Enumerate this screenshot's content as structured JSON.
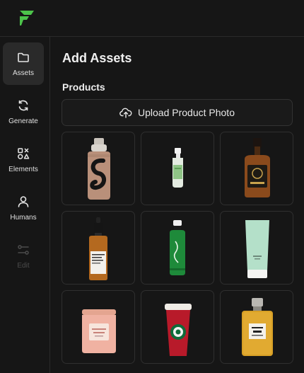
{
  "app": {
    "logo": "brand-logo"
  },
  "sidebar": {
    "items": [
      {
        "label": "Assets",
        "icon": "folder-icon",
        "active": true
      },
      {
        "label": "Generate",
        "icon": "refresh-icon"
      },
      {
        "label": "Elements",
        "icon": "shapes-icon"
      },
      {
        "label": "Humans",
        "icon": "user-icon"
      },
      {
        "label": "Edit",
        "icon": "sliders-icon",
        "disabled": true
      }
    ]
  },
  "main": {
    "title": "Add Assets",
    "section": "Products",
    "upload": {
      "label": "Upload Product Photo",
      "icon": "upload-cloud-icon"
    },
    "products": [
      {
        "name": "foundation-bottle"
      },
      {
        "name": "spray-bottle"
      },
      {
        "name": "whiskey-bottle"
      },
      {
        "name": "serum-dropper"
      },
      {
        "name": "green-bottle"
      },
      {
        "name": "lotion-tube"
      },
      {
        "name": "candle-jar"
      },
      {
        "name": "coffee-cup"
      },
      {
        "name": "perfume-bottle"
      }
    ]
  },
  "colors": {
    "accent": "#4cc34a",
    "background": "#161616",
    "border": "#2f2f2f"
  }
}
